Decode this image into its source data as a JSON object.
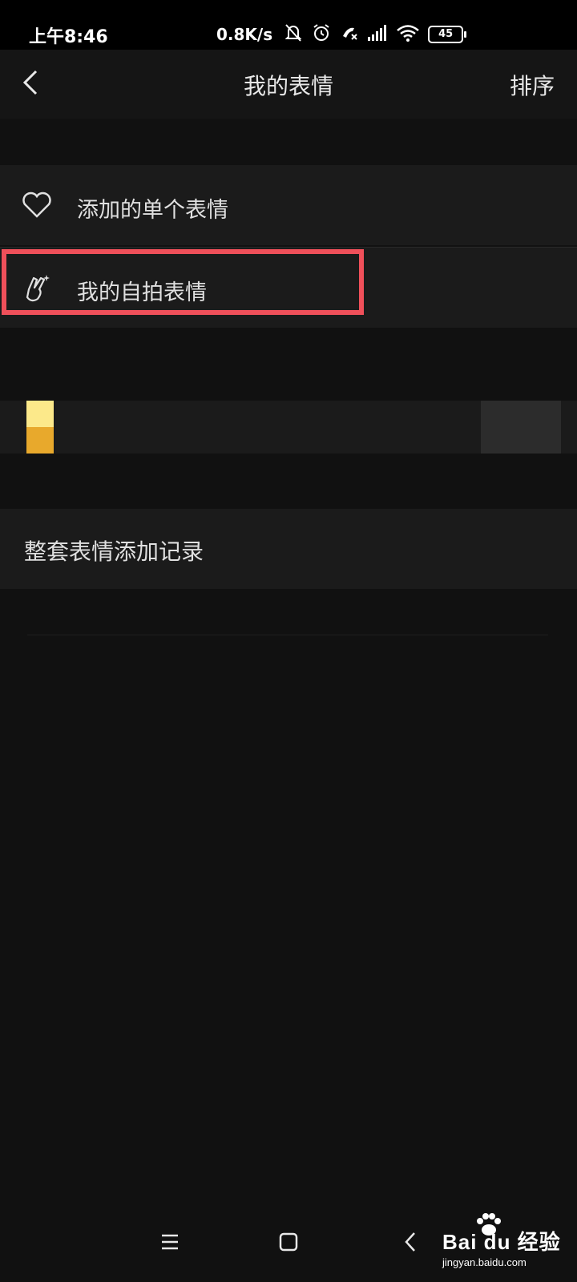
{
  "status_bar": {
    "time": "上午8:46",
    "net_speed": "0.8K/s",
    "battery": "45",
    "icons": [
      "bell-off-icon",
      "alarm-icon",
      "call-icon",
      "signal-icon",
      "wifi-icon",
      "battery-icon"
    ]
  },
  "header": {
    "title": "我的表情",
    "sort_label": "排序",
    "back_icon": "chevron-left-icon"
  },
  "list": {
    "items": [
      {
        "label": "添加的单个表情",
        "icon": "heart-icon"
      },
      {
        "label": "我的自拍表情",
        "icon": "selfie-hand-icon"
      }
    ]
  },
  "history": {
    "label": "整套表情添加记录"
  },
  "colors": {
    "background": "#111111",
    "row": "#1b1b1b",
    "highlight": "#f0505a"
  },
  "watermark": {
    "brand": "Bai du 经验",
    "site": "jingyan.baidu.com"
  }
}
